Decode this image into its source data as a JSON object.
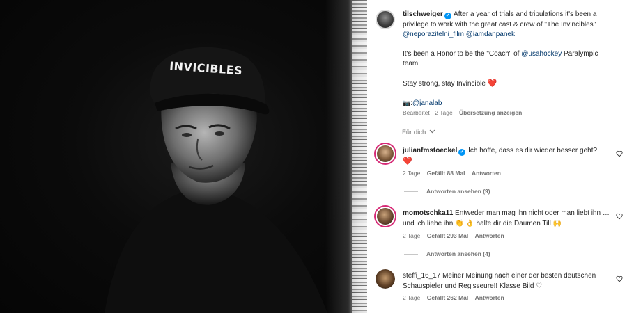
{
  "photo": {
    "cap_text": "INVICIBLES"
  },
  "post": {
    "username": "tilschweiger",
    "caption_line1": "After a year of trials and tribulations it's been a privilege to work with the great cast & crew of \"The Invincibles\"",
    "mention1": "@neporazitelni_film",
    "mention2": "@iamdanpanek",
    "para2_pre": "It's been a Honor to be the \"Coach\" of ",
    "para2_mention": "@usahockey",
    "para2_post": " Paralympic team",
    "para3": "Stay strong, stay Invincible ",
    "para3_heart": "❤️",
    "credit_icon": "📷",
    "credit_colon": ":",
    "credit_mention": "@janalab",
    "meta_edited": "Bearbeitet · 2 Tage",
    "meta_translate": "Übersetzung anzeigen"
  },
  "sort": {
    "label": "Für dich",
    "chevron": "chevron-down-icon"
  },
  "comments": [
    {
      "username": "julianfmstoeckel",
      "verified": true,
      "text": "Ich hoffe, dass es dir wieder besser geht?",
      "heart": "❤️",
      "age": "2 Tage",
      "likes": "Gefällt 88 Mal",
      "reply": "Antworten",
      "view_replies": "Antworten ansehen (9)"
    },
    {
      "username": "momotschka11",
      "text": "Entweder man mag ihn nicht oder man liebt ihn … und ich liebe ihn 👏 👌 halte dir die Daumen Till 🙌",
      "age": "2 Tage",
      "likes": "Gefällt 293 Mal",
      "reply": "Antworten",
      "view_replies": "Antworten ansehen (4)"
    },
    {
      "username": "steffi_16_17",
      "text": "Meiner Meinung nach einer der besten deutschen Schauspieler und Regisseure!! Klasse Bild ♡",
      "age": "2 Tage",
      "likes": "Gefällt 262 Mal",
      "reply": "Antworten"
    }
  ],
  "colors": {
    "verified": "#0095f6",
    "heart": "#ed4956",
    "mention": "#00376b",
    "muted": "#737373"
  }
}
